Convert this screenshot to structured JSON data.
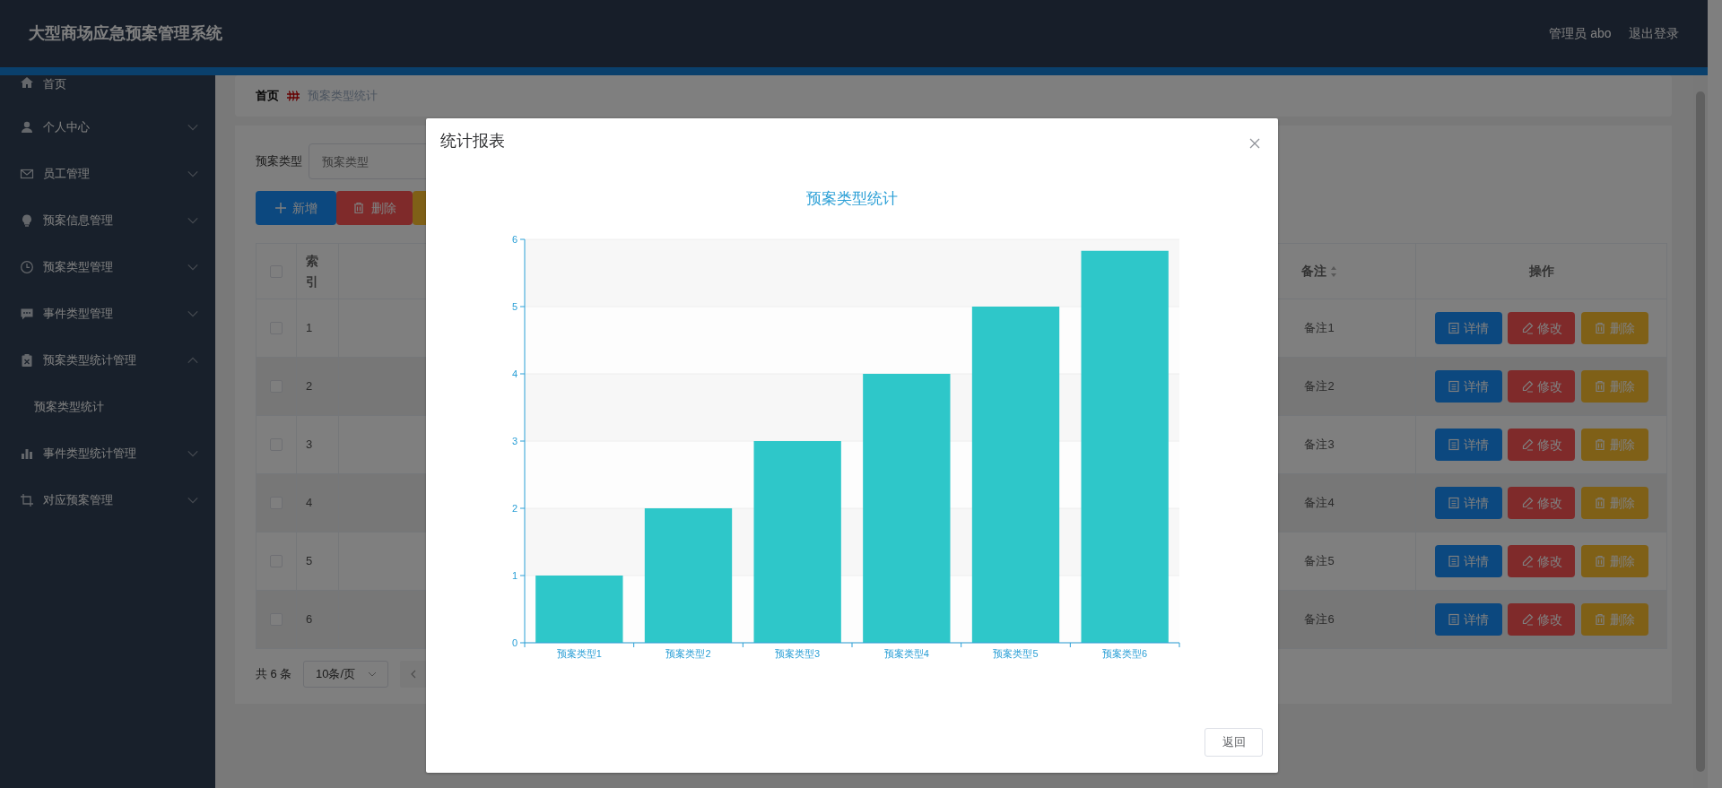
{
  "header": {
    "title": "大型商场应急预案管理系统",
    "user": "管理员 abo",
    "logout": "退出登录"
  },
  "sidebar": {
    "items": [
      {
        "label": "首页",
        "kind": "link"
      },
      {
        "label": "个人中心",
        "kind": "menu",
        "expanded": false
      },
      {
        "label": "员工管理",
        "kind": "menu",
        "expanded": false
      },
      {
        "label": "预案信息管理",
        "kind": "menu",
        "expanded": false
      },
      {
        "label": "预案类型管理",
        "kind": "menu",
        "expanded": false
      },
      {
        "label": "事件类型管理",
        "kind": "menu",
        "expanded": false
      },
      {
        "label": "预案类型统计管理",
        "kind": "menu",
        "expanded": true,
        "children": [
          {
            "label": "预案类型统计"
          }
        ]
      },
      {
        "label": "事件类型统计管理",
        "kind": "menu",
        "expanded": false
      },
      {
        "label": "对应预案管理",
        "kind": "menu",
        "expanded": false
      }
    ]
  },
  "breadcrumb": [
    "首页",
    "预案类型统计"
  ],
  "search": {
    "label": "预案类型",
    "placeholder": "预案类型"
  },
  "toolbar": [
    {
      "kind": "add",
      "label": "新增"
    },
    {
      "kind": "delete",
      "label": "删除"
    },
    {
      "kind": "other"
    }
  ],
  "table": {
    "columns": [
      {
        "kind": "check",
        "checked": false
      },
      {
        "kind": "text",
        "label": "索引"
      },
      {
        "kind": "hidden"
      },
      {
        "kind": "text",
        "label": "备注",
        "sortable": true
      },
      {
        "kind": "text",
        "label": "操作"
      }
    ],
    "rows": [
      {
        "checked": false,
        "index": "1",
        "remark": "备注1",
        "actions": [
          {
            "kind": "detail",
            "label": "详情"
          },
          {
            "kind": "edit",
            "label": "修改"
          },
          {
            "kind": "delete",
            "label": "删除"
          }
        ]
      },
      {
        "checked": false,
        "index": "2",
        "remark": "备注2",
        "actions": [
          {
            "kind": "detail",
            "label": "详情"
          },
          {
            "kind": "edit",
            "label": "修改"
          },
          {
            "kind": "delete",
            "label": "删除"
          }
        ]
      },
      {
        "checked": false,
        "index": "3",
        "remark": "备注3",
        "actions": [
          {
            "kind": "detail",
            "label": "详情"
          },
          {
            "kind": "edit",
            "label": "修改"
          },
          {
            "kind": "delete",
            "label": "删除"
          }
        ]
      },
      {
        "checked": false,
        "index": "4",
        "remark": "备注4",
        "actions": [
          {
            "kind": "detail",
            "label": "详情"
          },
          {
            "kind": "edit",
            "label": "修改"
          },
          {
            "kind": "delete",
            "label": "删除"
          }
        ]
      },
      {
        "checked": false,
        "index": "5",
        "remark": "备注5",
        "actions": [
          {
            "kind": "detail",
            "label": "详情"
          },
          {
            "kind": "edit",
            "label": "修改"
          },
          {
            "kind": "delete",
            "label": "删除"
          }
        ]
      },
      {
        "checked": false,
        "index": "6",
        "remark": "备注6",
        "actions": [
          {
            "kind": "detail",
            "label": "详情"
          },
          {
            "kind": "edit",
            "label": "修改"
          },
          {
            "kind": "delete",
            "label": "删除"
          }
        ]
      }
    ]
  },
  "pagination": {
    "total": "共 6 条",
    "page_size": "10条/页"
  },
  "modal": {
    "title": "统计报表",
    "back_button": "返回",
    "chart_data": {
      "type": "bar",
      "title": "预案类型统计",
      "categories": [
        "预案类型1",
        "预案类型2",
        "预案类型3",
        "预案类型4",
        "预案类型5",
        "预案类型6"
      ],
      "series": [
        {
          "color": "#2ec7c9",
          "values": [
            1,
            2,
            3,
            4,
            5,
            5.83
          ]
        }
      ],
      "ylim": [
        0,
        6
      ],
      "yticks": [
        0,
        1,
        2,
        3,
        4,
        5,
        6
      ],
      "grid": true
    }
  }
}
